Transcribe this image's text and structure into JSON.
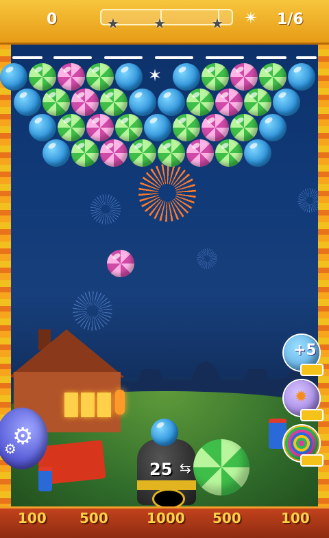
{
  "topbar": {
    "score": "0",
    "moves": "1/6",
    "stars_count": 3,
    "progress": 0.0
  },
  "bubble_grid": {
    "rows": [
      [
        "blue",
        "green",
        "pink",
        "green",
        "blue",
        null,
        "blue",
        "green",
        "pink",
        "green",
        "blue"
      ],
      [
        "blue",
        "green",
        "pink",
        "green",
        "blue",
        "blue",
        "green",
        "pink",
        "green",
        "blue"
      ],
      [
        "blue",
        "green",
        "pink",
        "green",
        "blue",
        "green",
        "pink",
        "green",
        "blue"
      ],
      [
        "blue",
        "green",
        "pink",
        "green",
        "green",
        "pink",
        "green",
        "blue"
      ]
    ]
  },
  "flying_bubble": {
    "color": "pink"
  },
  "shooter": {
    "ammo": "25",
    "current_bubble": "blue",
    "next_bubble": "green"
  },
  "powerups": [
    {
      "name": "plus-five",
      "label": "+5"
    },
    {
      "name": "fireball",
      "label": ""
    },
    {
      "name": "rainbow",
      "label": ""
    }
  ],
  "bins": [
    "100",
    "500",
    "1000",
    "500",
    "100"
  ],
  "colors": {
    "blue": "#2a8fd8",
    "green": "#3fbf4a",
    "pink": "#d04aa8",
    "topbar": "#f0b02a"
  }
}
